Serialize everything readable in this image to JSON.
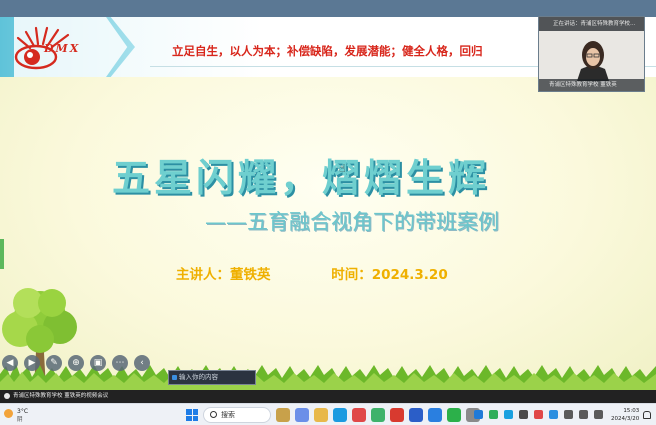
{
  "slide": {
    "logo_text": "DMX",
    "motto": "立足自生，以人为本；补偿缺陷，发展潜能；健全人格，回归",
    "title": "五星闪耀，熠熠生辉",
    "subtitle": "——五育融合视角下的带班案例",
    "speaker": "主讲人：董铁英",
    "time": "时间：2024.3.20"
  },
  "video": {
    "top_label": "正在讲话：青浦区特殊教育学校…",
    "bottom_label": "青浦区特殊教育学校 董铁英"
  },
  "meeting_bar": {
    "label": "青浦区特殊教育学校 董铁英的视频会议"
  },
  "ime_bar": {
    "label": "输入你的内容"
  },
  "taskbar": {
    "weather_temp": "3°C",
    "weather_cond": "阴",
    "search_placeholder": "搜索",
    "time": "15:03",
    "date": "2024/3/20"
  },
  "colors": {
    "title": "#6fcfcf",
    "subtitle": "#6cc6cc",
    "speaker": "#efb000",
    "motto": "#d8261b",
    "header_arrow": "#5fc3d9"
  }
}
